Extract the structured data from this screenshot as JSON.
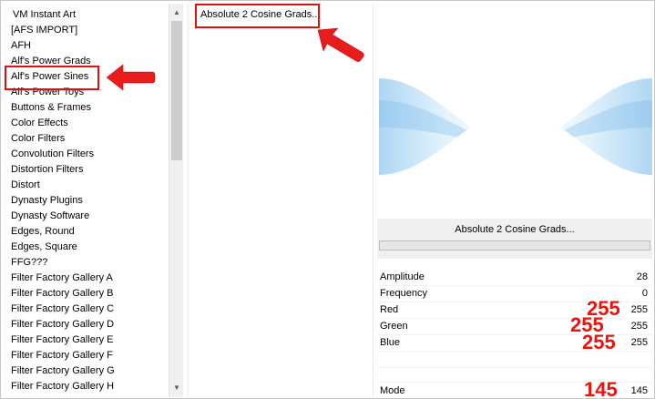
{
  "categories": [
    "VM Instant Art",
    "[AFS IMPORT]",
    "AFH",
    "Alf's Power Grads",
    "Alf's Power Sines",
    "Alf's Power Toys",
    "Buttons & Frames",
    "Color Effects",
    "Color Filters",
    "Convolution Filters",
    "Distortion Filters",
    "Distort",
    "Dynasty Plugins",
    "Dynasty Software",
    "Edges, Round",
    "Edges, Square",
    "FFG???",
    "Filter Factory Gallery A",
    "Filter Factory Gallery B",
    "Filter Factory Gallery C",
    "Filter Factory Gallery D",
    "Filter Factory Gallery E",
    "Filter Factory Gallery F",
    "Filter Factory Gallery G",
    "Filter Factory Gallery H"
  ],
  "filters": [
    "Absolute 2 Cosine Grads..."
  ],
  "selected_filter": "Absolute 2 Cosine Grads...",
  "parameters": [
    {
      "label": "Amplitude",
      "value": "28"
    },
    {
      "label": "Frequency",
      "value": "0"
    },
    {
      "label": "Red",
      "value": "255"
    },
    {
      "label": "Green",
      "value": "255"
    },
    {
      "label": "Blue",
      "value": "255"
    },
    {
      "label": "Mode",
      "value": "145"
    }
  ],
  "annotations": {
    "red": "255",
    "green": "255",
    "blue": "255",
    "mode": "145"
  },
  "colors": {
    "highlight": "#e11010",
    "annotation_text": "#e8140e",
    "scrollbar_thumb": "#cdcdcd",
    "preview_wave": "#9fcdf0"
  },
  "icons": [
    "scroll-up-arrow-icon",
    "scroll-down-arrow-icon",
    "pointer-arrow-icon"
  ]
}
